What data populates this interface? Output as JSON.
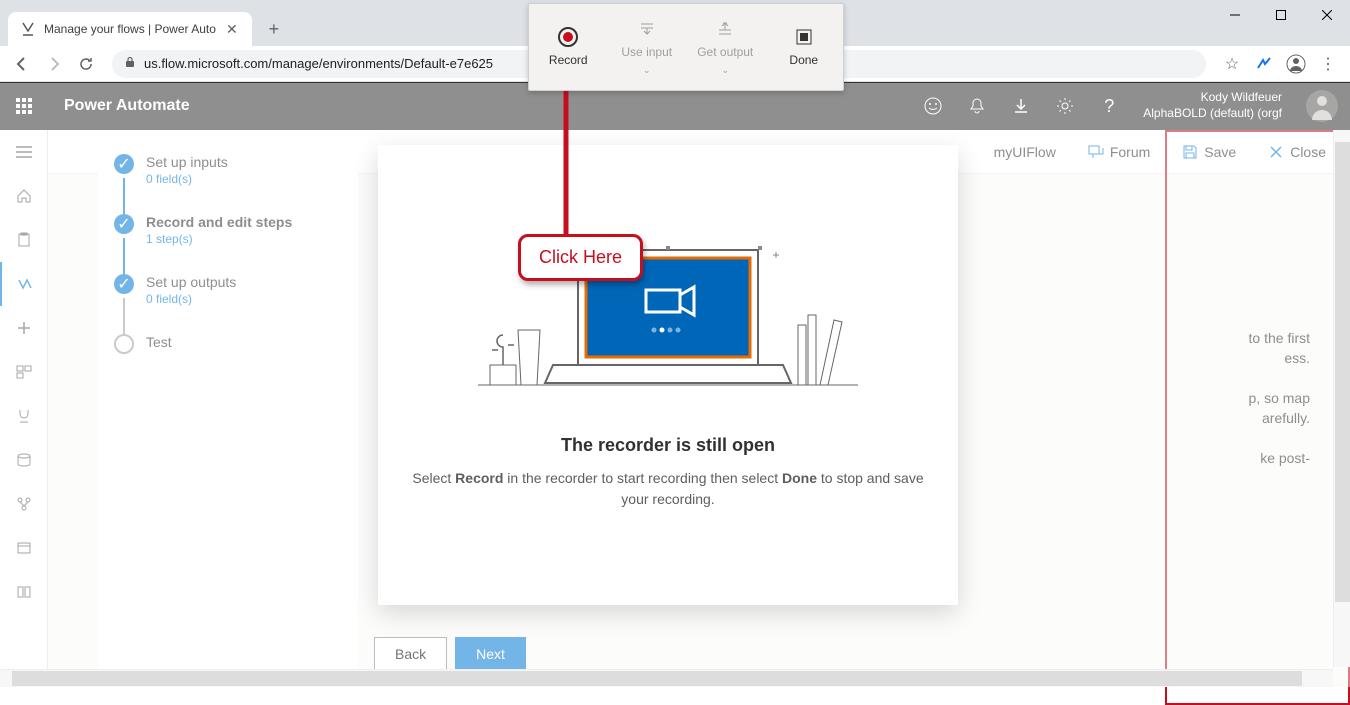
{
  "browser": {
    "tab_title": "Manage your flows | Power Auto",
    "url": "us.flow.microsoft.com/manage/environments/Default-e7e625"
  },
  "recorder": {
    "record": "Record",
    "use_input": "Use input",
    "get_output": "Get output",
    "done": "Done"
  },
  "callout": "Click Here",
  "header": {
    "app_title": "Power Automate",
    "user_name": "Kody Wildfeuer",
    "org": "AlphaBOLD (default) (orgf"
  },
  "command_bar": {
    "flow_name": "myUIFlow",
    "forum": "Forum",
    "save": "Save",
    "close": "Close"
  },
  "wizard": {
    "steps": [
      {
        "label": "Set up inputs",
        "sub": "0 field(s)"
      },
      {
        "label": "Record and edit steps",
        "sub": "1 step(s)"
      },
      {
        "label": "Set up outputs",
        "sub": "0 field(s)"
      },
      {
        "label": "Test",
        "sub": ""
      }
    ]
  },
  "modal": {
    "title": "The recorder is still open",
    "text_pre": "Select ",
    "text_b1": "Record",
    "text_mid": " in the recorder to start recording then select ",
    "text_b2": "Done",
    "text_post": " to stop and save your recording."
  },
  "behind": {
    "l1": "to the first",
    "l2": "ess.",
    "l3": "p, so map",
    "l4": "arefully.",
    "l5": "ke post-"
  },
  "buttons": {
    "back": "Back",
    "next": "Next"
  }
}
